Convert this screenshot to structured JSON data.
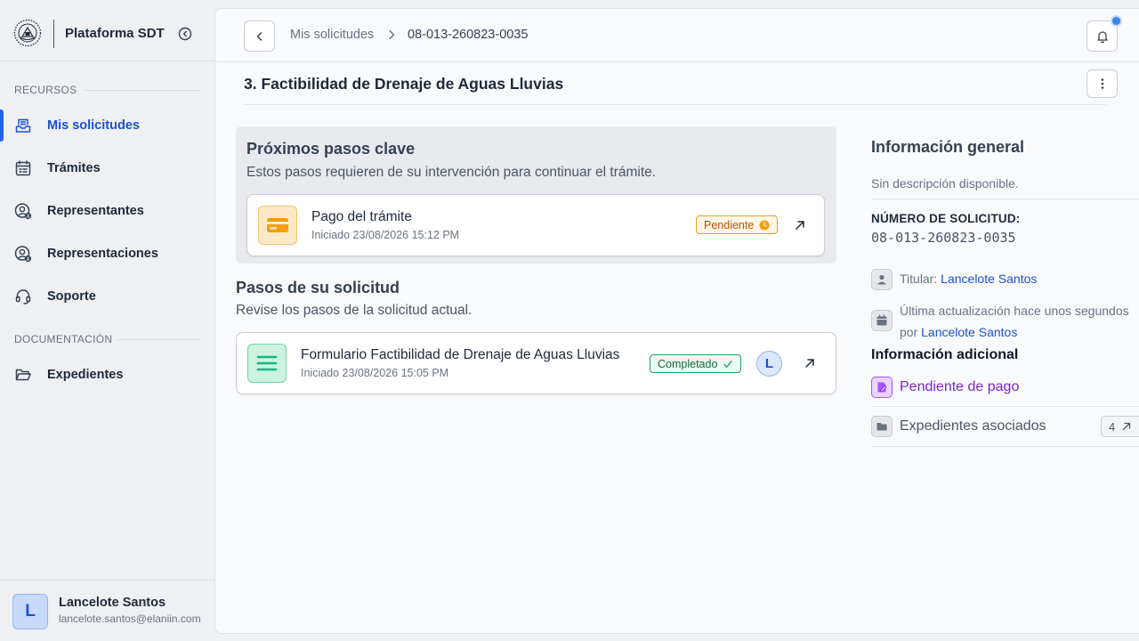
{
  "brand": {
    "title": "Plataforma SDT"
  },
  "sidebar": {
    "sections": [
      {
        "label": "RECURSOS"
      },
      {
        "label": "DOCUMENTACIÓN"
      }
    ],
    "items": [
      {
        "label": "Mis solicitudes",
        "icon": "inbox-tray-icon",
        "active": true
      },
      {
        "label": "Trámites",
        "icon": "calendar-list-icon"
      },
      {
        "label": "Representantes",
        "icon": "user-circle-icon"
      },
      {
        "label": "Representaciones",
        "icon": "user-circle-icon"
      },
      {
        "label": "Soporte",
        "icon": "headset-icon"
      },
      {
        "label": "Expedientes",
        "icon": "folder-open-icon"
      }
    ]
  },
  "user": {
    "initial": "L",
    "name": "Lancelote Santos",
    "email": "lancelote.santos@elaniin.com"
  },
  "breadcrumb": {
    "parent": "Mis solicitudes",
    "current": "08-013-260823-0035"
  },
  "page": {
    "title": "3. Factibilidad de Drenaje de Aguas Lluvias"
  },
  "key_steps": {
    "title": "Próximos pasos clave",
    "description": "Estos pasos requieren de su intervención para continuar el trámite.",
    "items": [
      {
        "name": "Pago del trámite",
        "date": "Iniciado 23/08/2026 15:12 PM",
        "status": "Pendiente",
        "icon": "credit-card-icon"
      }
    ]
  },
  "steps": {
    "title": "Pasos de su solicitud",
    "description": "Revise los pasos de la solicitud actual.",
    "items": [
      {
        "name": "Formulario Factibilidad de Drenaje de Aguas Lluvias",
        "date": "Iniciado 23/08/2026 15:05 PM",
        "status": "Completado",
        "assignee": "L",
        "icon": "list-lines-icon"
      }
    ]
  },
  "info": {
    "title": "Información general",
    "description": "Sin descripción disponible.",
    "request_label": "NÚMERO DE SOLICITUD:",
    "request_number": "08-013-260823-0035",
    "holder_prefix": "Titular:",
    "holder_name": "Lancelote Santos",
    "updated_text": "Última actualización hace unos segundos",
    "updated_by_prefix": "por",
    "updated_by_name": "Lancelote Santos",
    "additional_title": "Información adicional",
    "status_text": "Pendiente de pago",
    "files_label": "Expedientes asociados",
    "files_count": "4"
  },
  "colors": {
    "accent": "#2563eb",
    "pending": "#e0a02a",
    "completed": "#22a06b",
    "status_purple": "#7e22ce"
  }
}
